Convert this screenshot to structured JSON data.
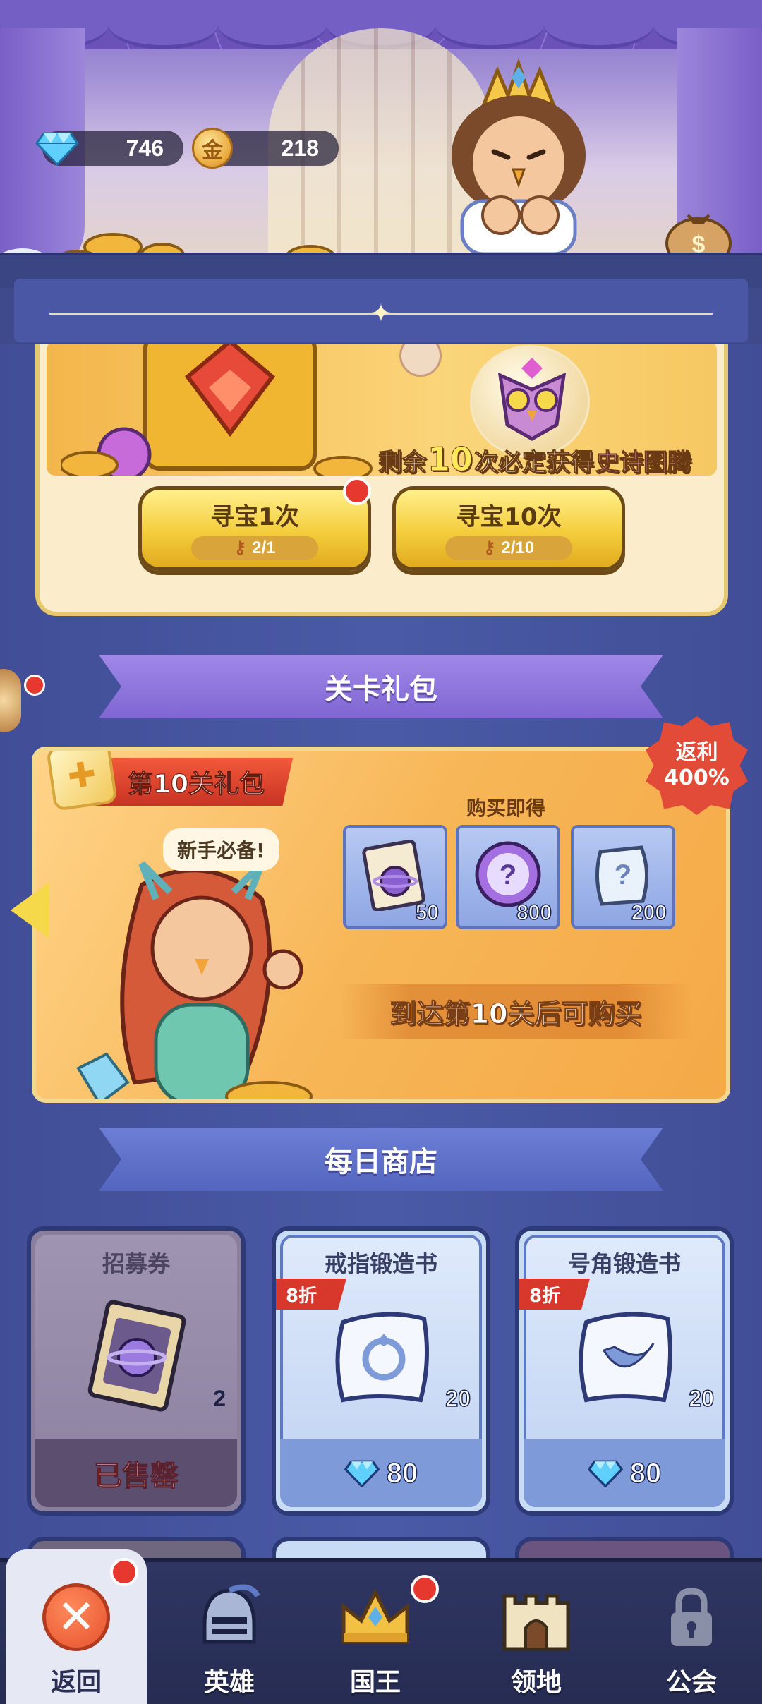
{
  "currencies": {
    "gems": "746",
    "coins": "218",
    "coin_symbol": "金"
  },
  "treasure": {
    "epic_prefix": "剩余",
    "epic_count": "10",
    "epic_mid": "次必定获得",
    "epic_item": "史诗图腾",
    "hunt_once": {
      "label": "寻宝1次",
      "cost": "2/1"
    },
    "hunt_ten": {
      "label": "寻宝10次",
      "cost": "2/10"
    }
  },
  "stage_gift": {
    "section_title": "关卡礼包",
    "title": "第10关礼包",
    "speech": "新手必备!",
    "buy_to_get": "购买即得",
    "return_rate_line1": "返利",
    "return_rate_line2": "400%",
    "items": [
      {
        "name": "recruit-ticket",
        "qty": "50"
      },
      {
        "name": "mystery-orb",
        "qty": "800"
      },
      {
        "name": "mystery-scroll",
        "qty": "200"
      }
    ],
    "unlock_text": "到达第10关后可购买"
  },
  "daily_shop": {
    "section_title": "每日商店",
    "items": [
      {
        "name": "招募券",
        "qty": "2",
        "status": "已售罄"
      },
      {
        "name": "戒指锻造书",
        "qty": "20",
        "discount": "8折",
        "price": "80"
      },
      {
        "name": "号角锻造书",
        "qty": "20",
        "discount": "8折",
        "price": "80"
      }
    ]
  },
  "nav": {
    "back": "返回",
    "heroes": "英雄",
    "king": "国王",
    "territory": "领地",
    "guild": "公会"
  },
  "colors": {
    "gem": "#4fc3f7",
    "coin": "#e8a83b",
    "alert": "#e6382f",
    "accent_purple": "#8a74d2"
  }
}
